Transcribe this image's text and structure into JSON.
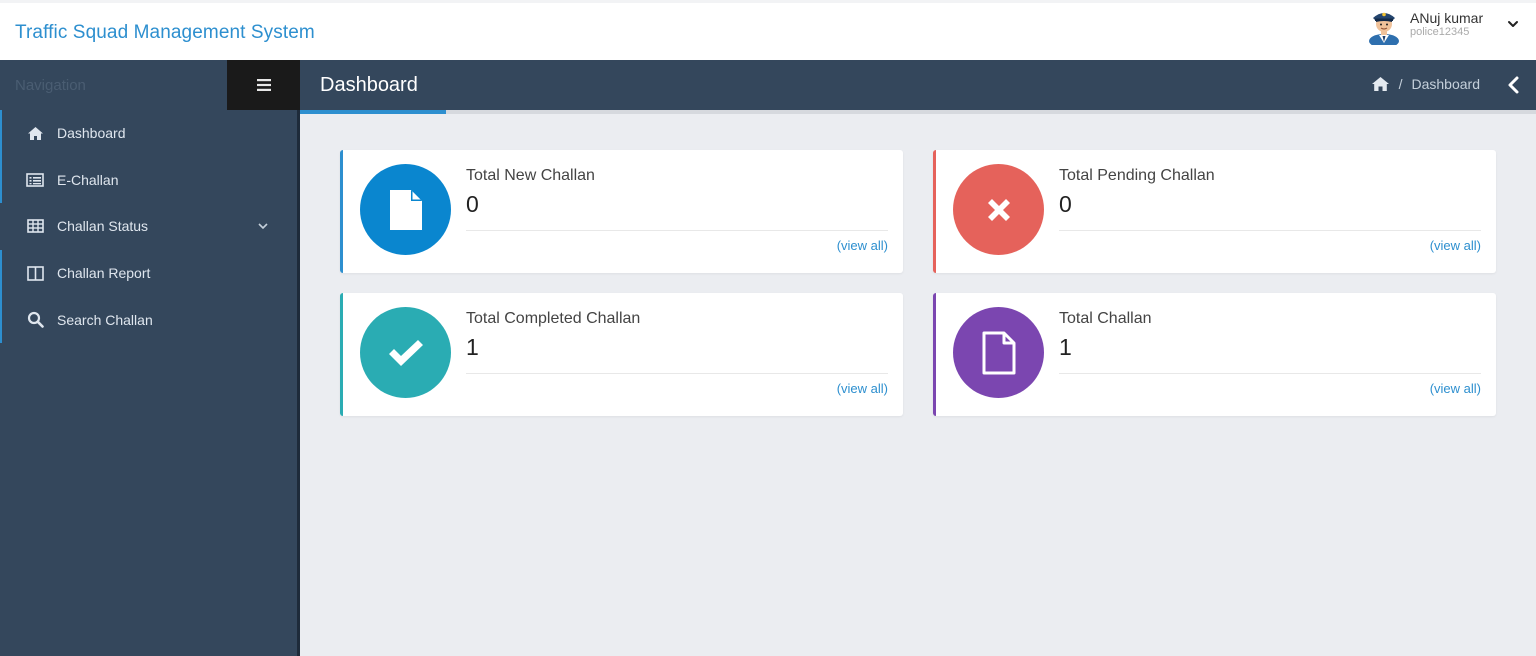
{
  "header": {
    "brand": "Traffic Squad Management System",
    "user_name": "ANuj kumar",
    "user_id": "police12345",
    "avatar_icon": "police-officer-avatar",
    "caret_icon": "chevron-down-icon"
  },
  "sidebar": {
    "nav_label": "Navigation",
    "toggle_icon": "hamburger-icon",
    "items": [
      {
        "label": "Dashboard",
        "icon": "home-icon"
      },
      {
        "label": "E-Challan",
        "icon": "list-card-icon"
      },
      {
        "label": "Challan Status",
        "icon": "table-grid-icon",
        "has_submenu": true
      },
      {
        "label": "Challan Report",
        "icon": "columns-icon"
      },
      {
        "label": "Search Challan",
        "icon": "search-icon"
      }
    ]
  },
  "page": {
    "title": "Dashboard",
    "breadcrumb_home_icon": "home-icon",
    "breadcrumb_sep": "/",
    "breadcrumb_current": "Dashboard",
    "back_icon": "chevron-left-icon"
  },
  "cards": [
    {
      "label": "Total New Challan",
      "count": "0",
      "link": "(view all)",
      "icon": "file-icon",
      "color": "#0a86cf",
      "accent": "#2d8fcf"
    },
    {
      "label": "Total Pending Challan",
      "count": "0",
      "link": "(view all)",
      "icon": "close-icon",
      "color": "#e5625b",
      "accent": "#e5625b"
    },
    {
      "label": "Total Completed Challan",
      "count": "1",
      "link": "(view all)",
      "icon": "check-icon",
      "color": "#2aacb3",
      "accent": "#2aacb3"
    },
    {
      "label": "Total Challan",
      "count": "1",
      "link": "(view all)",
      "icon": "file-outline-icon",
      "color": "#7b46b0",
      "accent": "#7b46b0"
    }
  ],
  "colors": {
    "brand": "#2d8fcf",
    "sidebar_bg": "#34475c",
    "content_bg": "#ebedf1"
  }
}
